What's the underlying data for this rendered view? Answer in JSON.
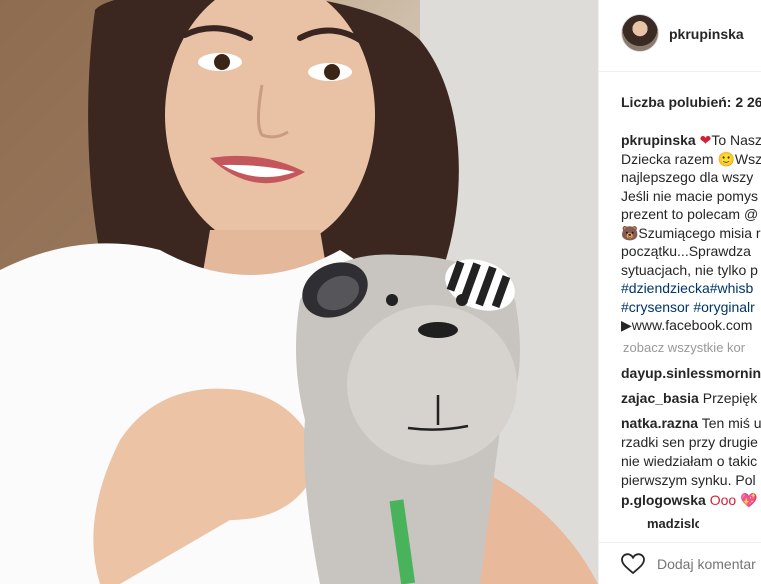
{
  "post": {
    "username": "pkrupinska",
    "likes_text": "Liczba polubień: 2 26",
    "caption_lines": [
      {
        "author": "pkrupinska",
        "heart": "❤",
        "text": "To Nasz"
      },
      {
        "text": "Dziecka razem 🙂Wsz"
      },
      {
        "text": "najlepszego dla wszy"
      },
      {
        "text": "Jeśli nie macie pomys"
      },
      {
        "text": "prezent to polecam @"
      },
      {
        "text": "🐻Szumiącego misia r"
      },
      {
        "text": "początku...Sprawdza"
      },
      {
        "text": "sytuacjach, nie tylko p"
      },
      {
        "tag": "#dziendziecka#whisb"
      },
      {
        "tag": "#crysensor #oryginalr"
      },
      {
        "text": "▶www.facebook.com"
      }
    ],
    "view_all_text": "zobacz wszystkie kor",
    "comments": [
      {
        "user": "dayup.sinlessmorning",
        "lines": []
      },
      {
        "user": "zajac_basia",
        "lines": [
          "Przepięk"
        ]
      },
      {
        "user": "natka.razna",
        "lines": [
          "Ten miś u",
          "rzadki sen przy drugie",
          "nie wiedziałam o takic",
          "pierwszym synku. Pol"
        ]
      },
      {
        "user": "p.glogowska",
        "lines": [
          "Ooo 💖"
        ]
      },
      {
        "user": "madzislonka",
        "lines": []
      }
    ],
    "add_comment_placeholder": "Dodaj komentar",
    "icons": {
      "like": "heart-outline-icon",
      "avatar": "user-avatar"
    },
    "colors": {
      "hashtag": "#003569",
      "muted": "#999999",
      "text": "#262626"
    }
  }
}
